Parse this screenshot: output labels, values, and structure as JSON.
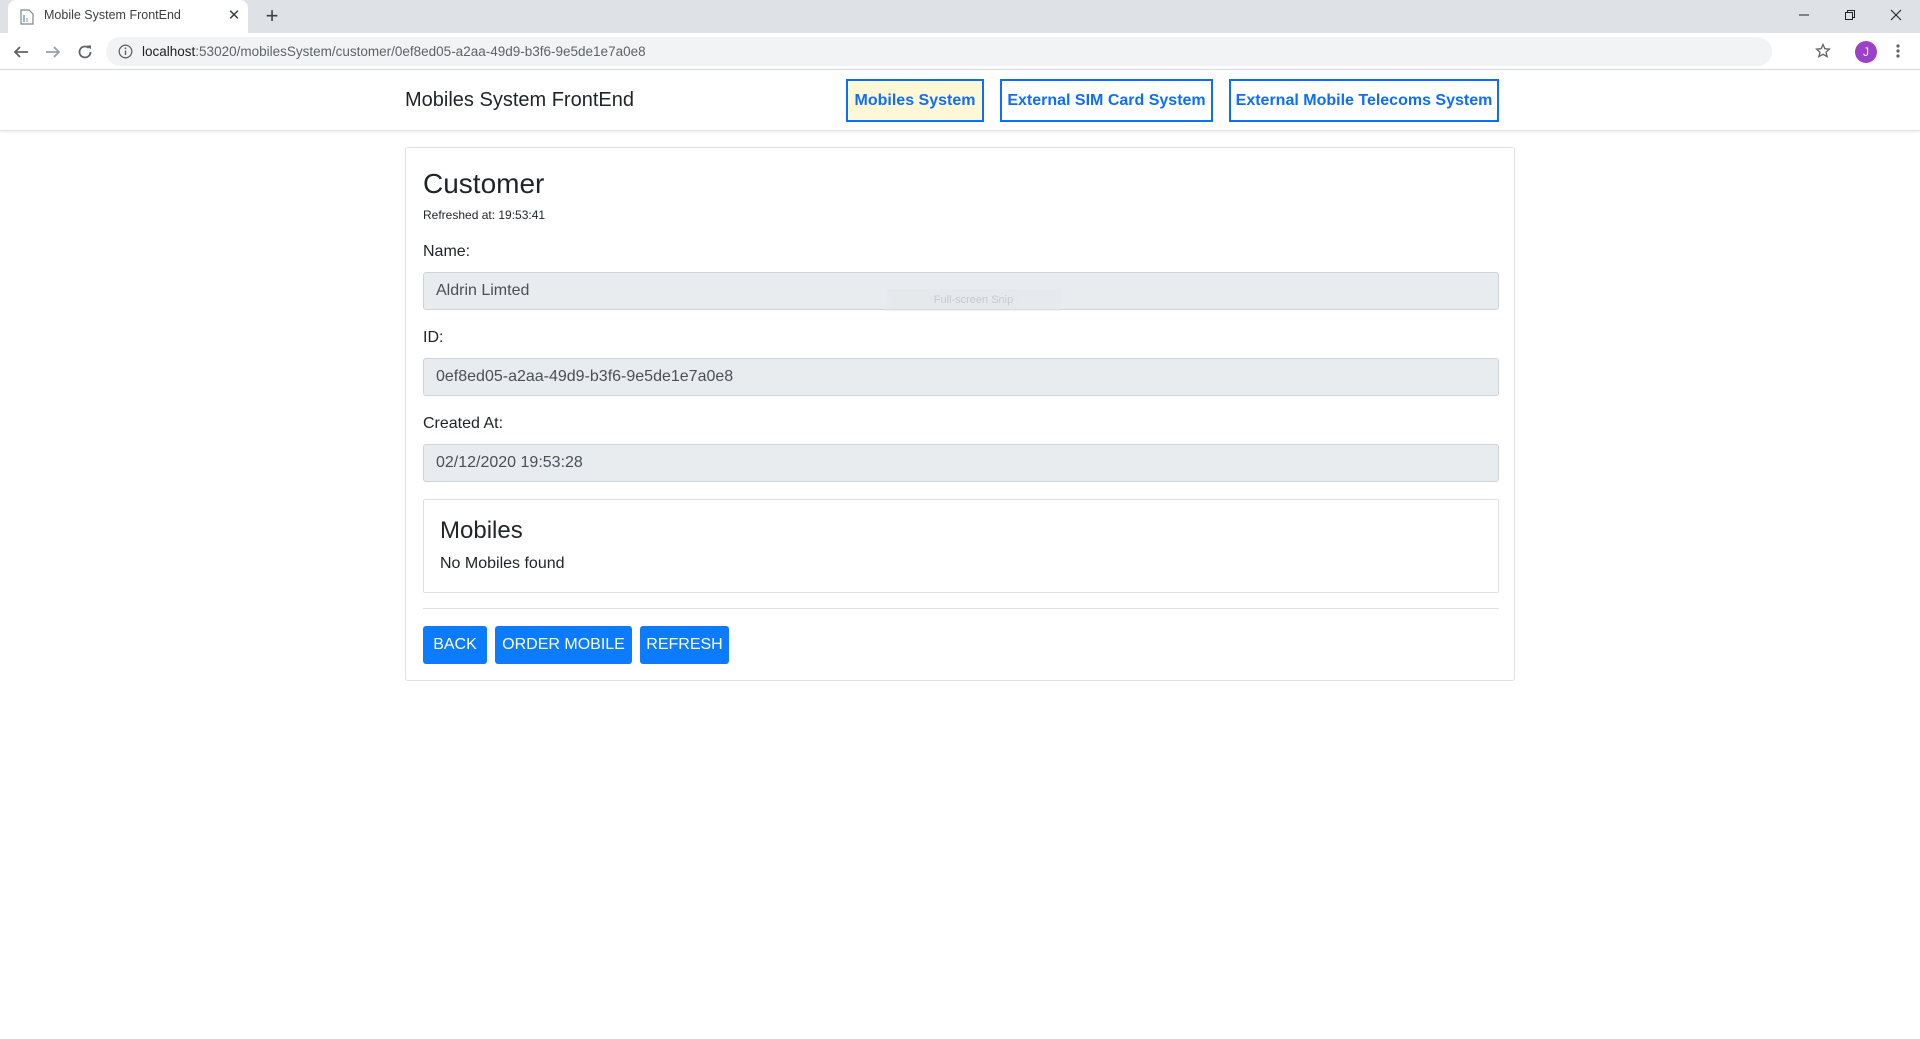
{
  "browser": {
    "tab_title": "Mobile System FrontEnd",
    "url_host": "localhost",
    "url_rest": ":53020/mobilesSystem/customer/0ef8ed05-a2aa-49d9-b3f6-9e5de1e7a0e8",
    "avatar_letter": "J",
    "avatar_color": "#9c42c8"
  },
  "nav": {
    "brand": "Mobiles System FrontEnd",
    "links": [
      {
        "label": "Mobiles System",
        "active": true
      },
      {
        "label": "External SIM Card System",
        "active": false
      },
      {
        "label": "External Mobile Telecoms System",
        "active": false
      }
    ],
    "accent_color": "#0d6efd",
    "active_bg": "#fff8d6"
  },
  "customer": {
    "title": "Customer",
    "refreshed": "Refreshed at: 19:53:41",
    "fields": {
      "name_label": "Name:",
      "name_value": "Aldrin Limted",
      "id_label": "ID:",
      "id_value": "0ef8ed05-a2aa-49d9-b3f6-9e5de1e7a0e8",
      "created_label": "Created At:",
      "created_value": "02/12/2020 19:53:28"
    },
    "overlay_hint": "Full-screen Snip"
  },
  "mobiles": {
    "title": "Mobiles",
    "empty": "No Mobiles found"
  },
  "actions": {
    "back": "BACK",
    "order": "ORDER MOBILE",
    "refresh": "REFRESH"
  }
}
